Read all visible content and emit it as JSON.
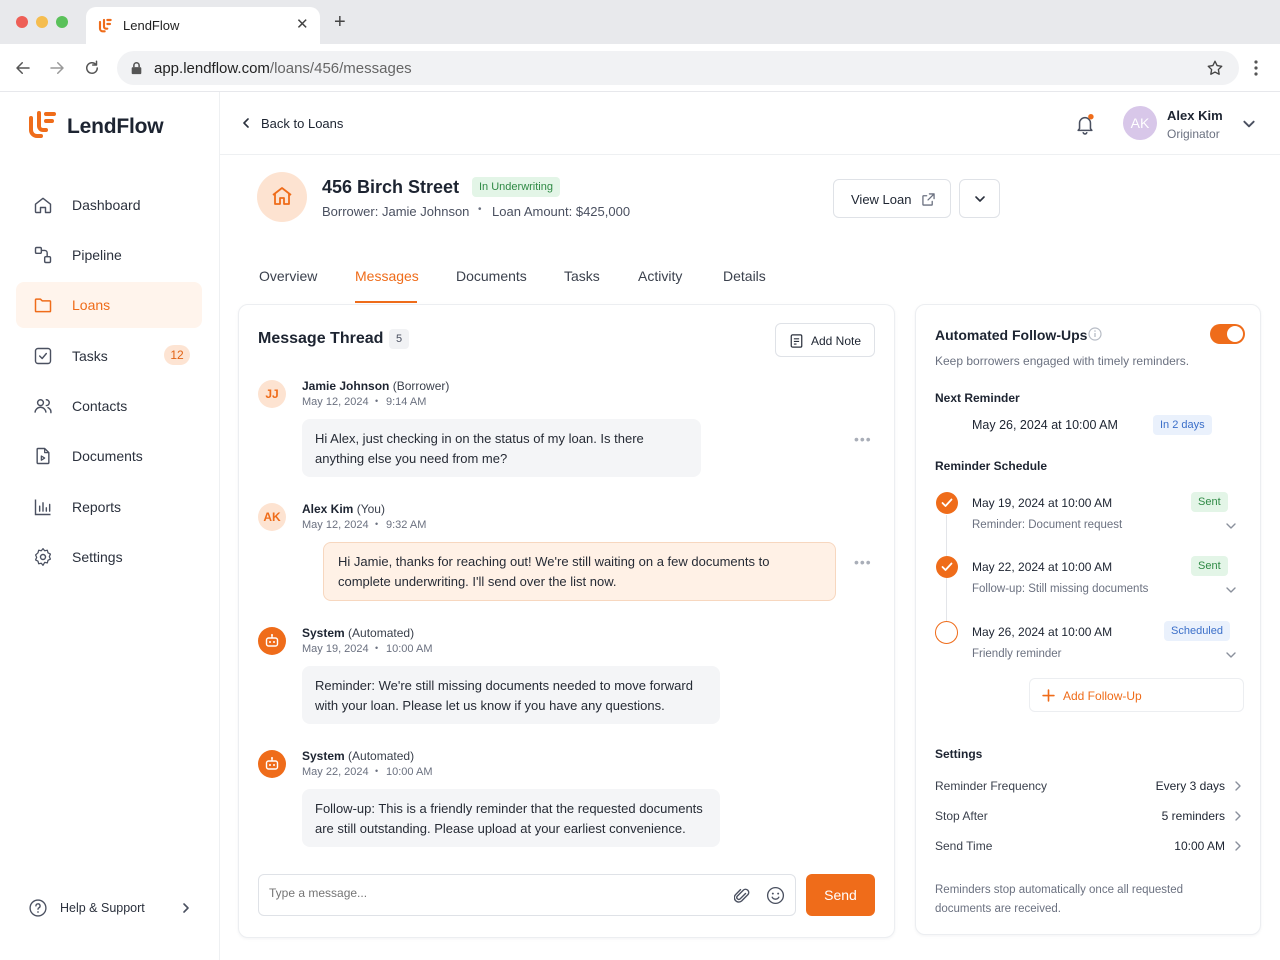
{
  "browser": {
    "tab_title": "LendFlow",
    "url_host": "app.lendflow.com",
    "url_path": "/loans/456/messages",
    "close_glyph": "✕",
    "newtab_glyph": "+"
  },
  "brand": {
    "name": "LendFlow",
    "color": "#ef6c1a"
  },
  "sidebar": {
    "items": [
      {
        "label": "Dashboard",
        "icon": "dashboard-icon"
      },
      {
        "label": "Pipeline",
        "icon": "pipeline-icon"
      },
      {
        "label": "Loans",
        "icon": "folder-icon",
        "active": true
      },
      {
        "label": "Tasks",
        "icon": "tasks-icon",
        "badge": "12"
      },
      {
        "label": "Contacts",
        "icon": "contacts-icon"
      },
      {
        "label": "Documents",
        "icon": "document-icon"
      },
      {
        "label": "Reports",
        "icon": "reports-icon"
      },
      {
        "label": "Settings",
        "icon": "gear-icon"
      }
    ],
    "help_label": "Help & Support"
  },
  "header": {
    "back_label": "Back to Loans",
    "user_name": "Alex Kim",
    "user_role": "Originator",
    "user_initials": "AK"
  },
  "loan": {
    "title": "456 Birch Street",
    "status": "In Underwriting",
    "borrower": "Borrower: Jamie Johnson",
    "separator": "•",
    "amount": "Loan Amount: $425,000",
    "view_loan_label": "View Loan"
  },
  "tabs": [
    "Overview",
    "Messages",
    "Documents",
    "Tasks",
    "Activity",
    "Details"
  ],
  "thread": {
    "title": "Message Thread",
    "count": "5",
    "add_note_label": "Add Note",
    "composer_placeholder": "Type a message...",
    "send_label": "Send",
    "more_glyph": "•••",
    "messages": [
      {
        "initials": "JJ",
        "name": "Jamie Johnson",
        "role": " (Borrower)",
        "date": "May 12, 2024",
        "sep": "•",
        "time": "9:14 AM",
        "text": "Hi Alex, just checking in on the status of my loan. Is there anything else you need from me?"
      },
      {
        "initials": "AK",
        "name": "Alex Kim",
        "role": " (You)",
        "date": "May 12, 2024",
        "sep": "•",
        "time": "9:32 AM",
        "text": "Hi Jamie, thanks for reaching out! We're still waiting on a few documents to complete underwriting. I'll send over the list now."
      },
      {
        "initials": "",
        "name": "System",
        "role": " (Automated)",
        "date": "May 19, 2024",
        "sep": "•",
        "time": "10:00 AM",
        "text": "Reminder: We're still missing documents needed to move forward with your loan. Please let us know if you have any questions."
      },
      {
        "initials": "",
        "name": "System",
        "role": " (Automated)",
        "date": "May 22, 2024",
        "sep": "•",
        "time": "10:00 AM",
        "text": "Follow-up: This is a friendly reminder that the requested documents are still outstanding. Please upload at your earliest convenience."
      }
    ]
  },
  "followups": {
    "title": "Automated Follow-Ups",
    "enabled": true,
    "subtitle": "Keep borrowers engaged with timely reminders.",
    "next_label": "Next Reminder",
    "next_value": "May 26, 2024 at 10:00 AM",
    "next_badge": "In 2 days",
    "schedule_label": "Reminder Schedule",
    "schedule": [
      {
        "date": "May 19, 2024 at 10:00 AM",
        "desc": "Reminder: Document request",
        "status": "Sent"
      },
      {
        "date": "May 22, 2024 at 10:00 AM",
        "desc": "Follow-up: Still missing documents",
        "status": "Sent"
      },
      {
        "date": "May 26, 2024 at 10:00 AM",
        "desc": "Friendly reminder",
        "status": "Scheduled"
      }
    ],
    "add_label": "Add Follow-Up",
    "settings_label": "Settings",
    "settings": [
      {
        "label": "Reminder Frequency",
        "value": "Every 3 days"
      },
      {
        "label": "Stop After",
        "value": "5 reminders"
      },
      {
        "label": "Send Time",
        "value": "10:00 AM"
      }
    ],
    "footer_note": "Reminders stop automatically once all requested documents are received."
  }
}
